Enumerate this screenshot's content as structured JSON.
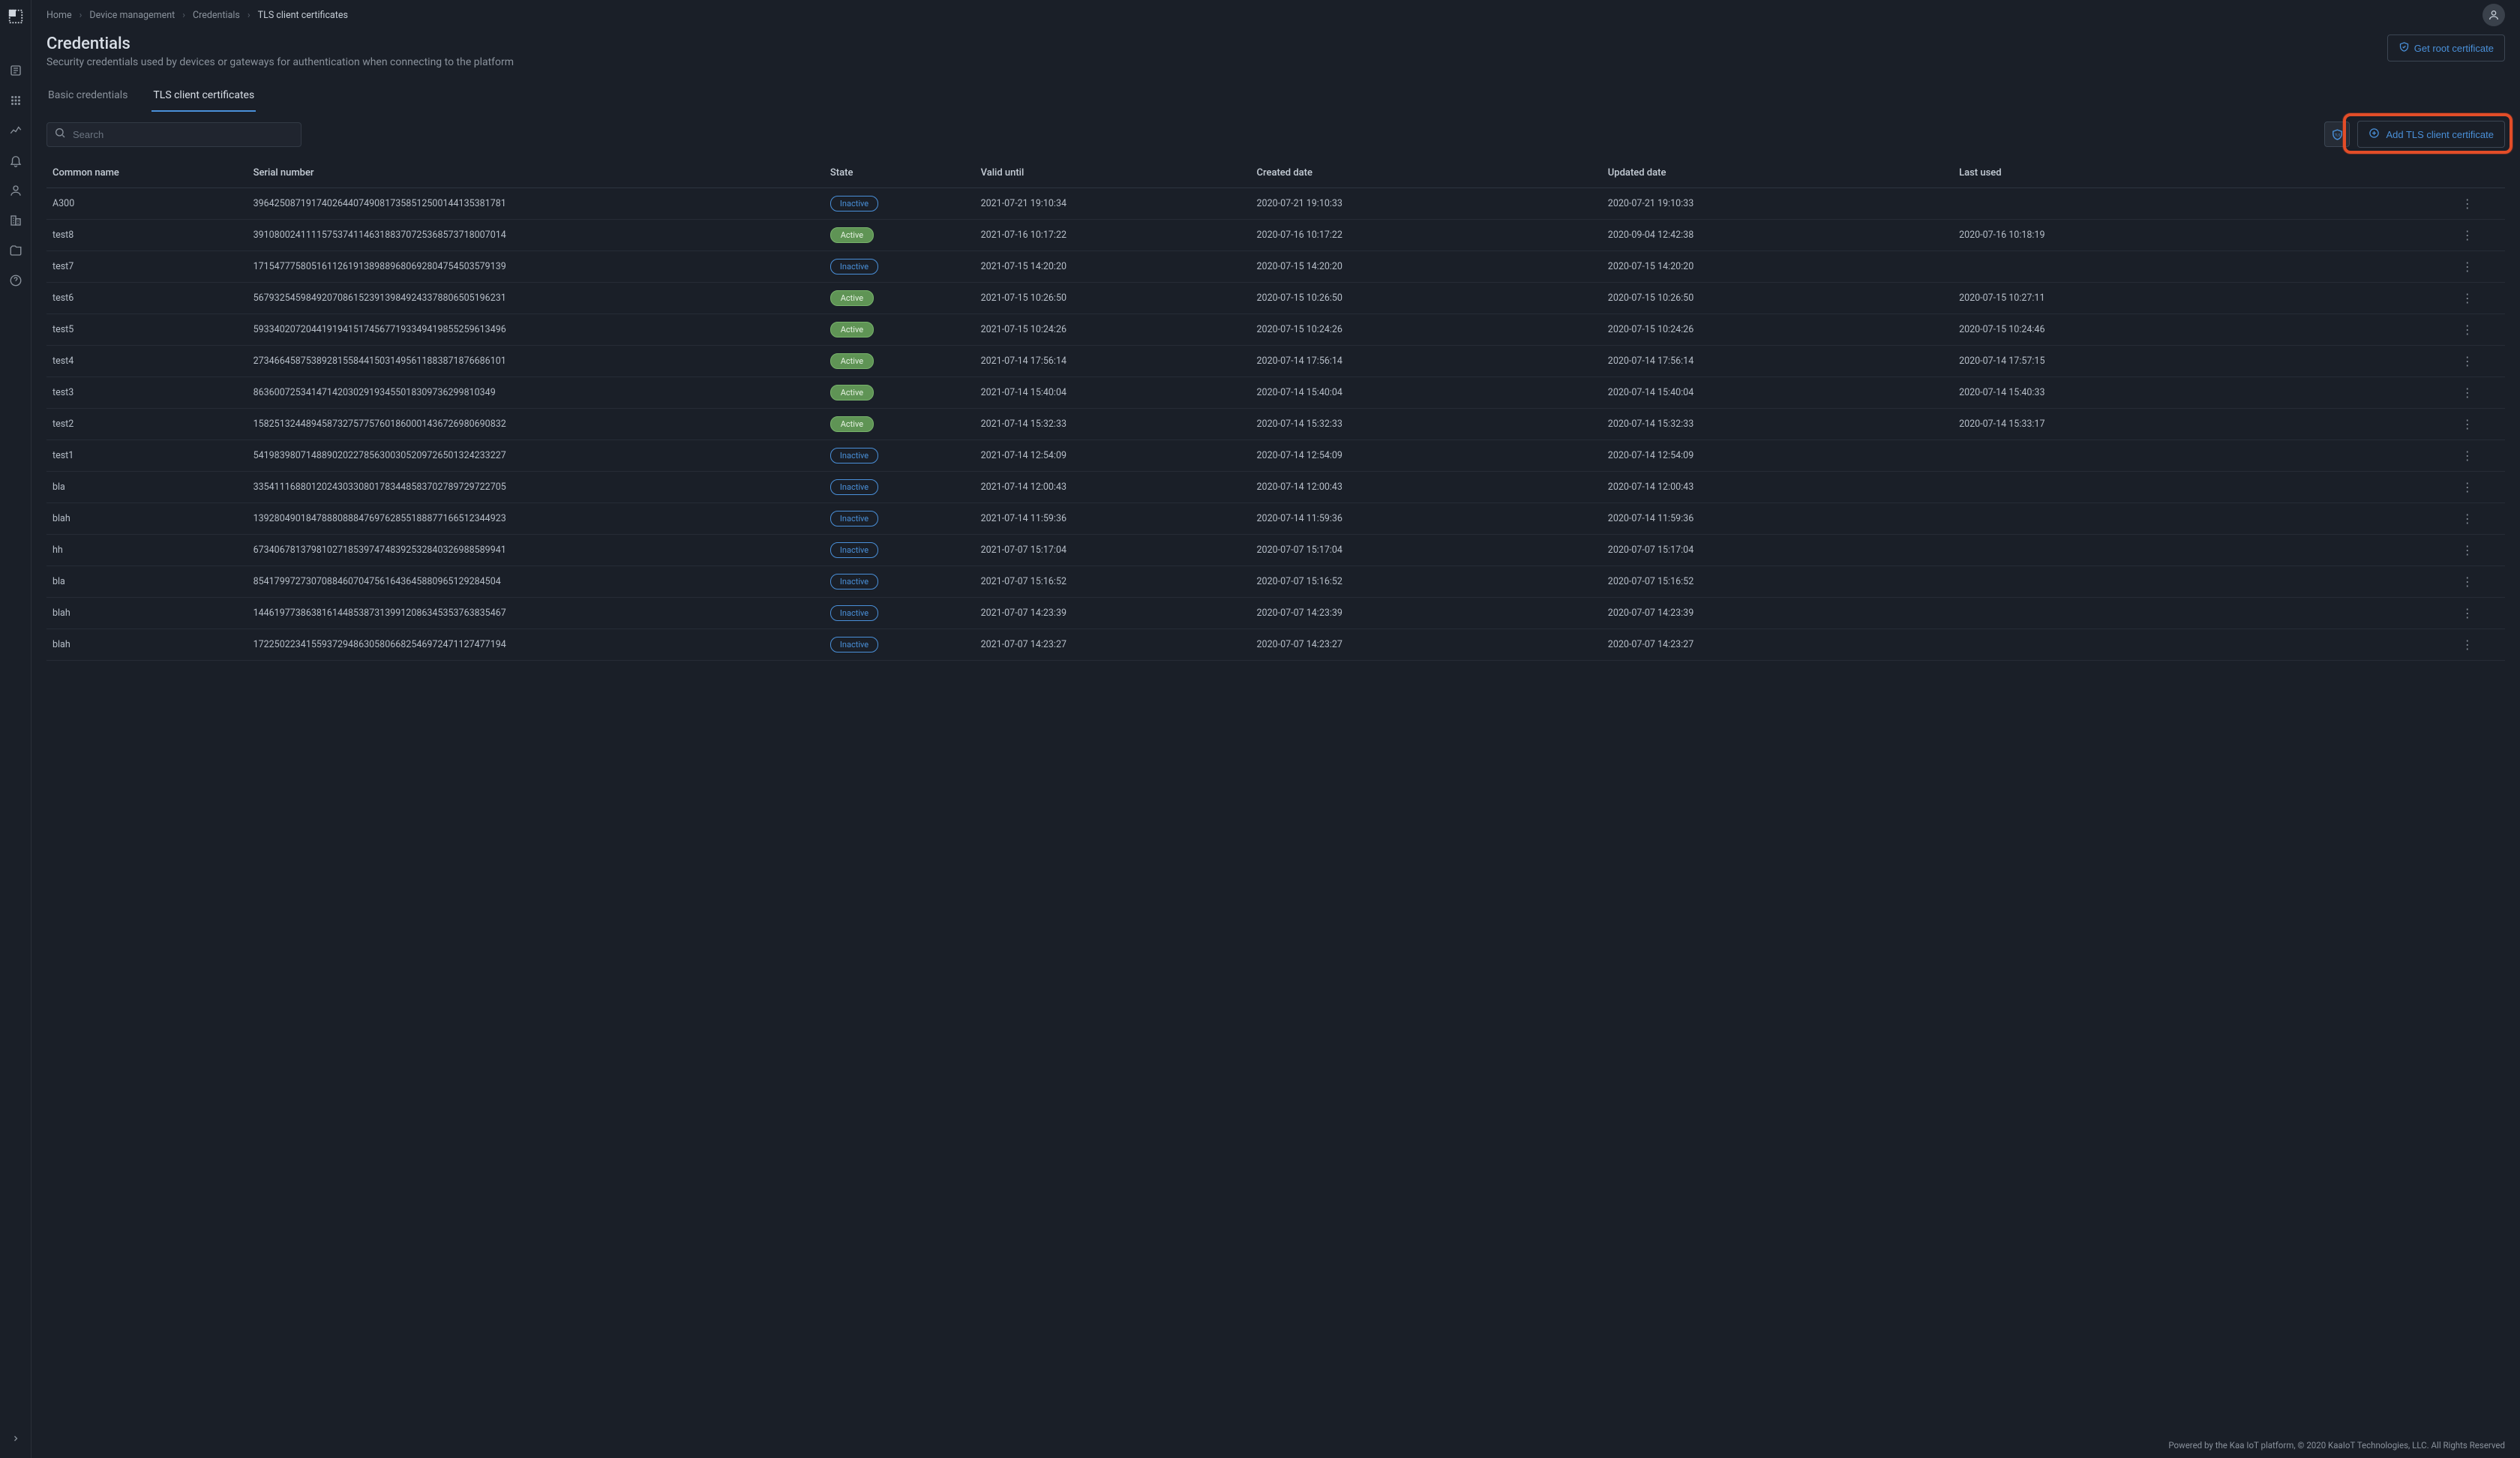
{
  "breadcrumb": [
    {
      "label": "Home"
    },
    {
      "label": "Device management"
    },
    {
      "label": "Credentials"
    },
    {
      "label": "TLS client certificates",
      "active": true
    }
  ],
  "header": {
    "title": "Credentials",
    "subtitle": "Security credentials used by devices or gateways for authentication when connecting to the platform",
    "get_root_cert": "Get root certificate"
  },
  "tabs": [
    {
      "label": "Basic credentials",
      "active": false
    },
    {
      "label": "TLS client certificates",
      "active": true
    }
  ],
  "search": {
    "placeholder": "Search"
  },
  "toolbar": {
    "add_tls": "Add TLS client certificate"
  },
  "columns": {
    "common": "Common name",
    "serial": "Serial number",
    "state": "State",
    "valid": "Valid until",
    "created": "Created date",
    "updated": "Updated date",
    "last": "Last used"
  },
  "rows": [
    {
      "common": "A300",
      "serial": "396425087191740264407490817358512500144135381781",
      "state": "Inactive",
      "valid": "2021-07-21 19:10:34",
      "created": "2020-07-21 19:10:33",
      "updated": "2020-07-21 19:10:33",
      "last": ""
    },
    {
      "common": "test8",
      "serial": "391080024111157537411463188370725368573718007014",
      "state": "Active",
      "valid": "2021-07-16 10:17:22",
      "created": "2020-07-16 10:17:22",
      "updated": "2020-09-04 12:42:38",
      "last": "2020-07-16 10:18:19"
    },
    {
      "common": "test7",
      "serial": "171547775805161126191389889680692804754503579139",
      "state": "Inactive",
      "valid": "2021-07-15 14:20:20",
      "created": "2020-07-15 14:20:20",
      "updated": "2020-07-15 14:20:20",
      "last": ""
    },
    {
      "common": "test6",
      "serial": "567932545984920708615239139849243378806505196231",
      "state": "Active",
      "valid": "2021-07-15 10:26:50",
      "created": "2020-07-15 10:26:50",
      "updated": "2020-07-15 10:26:50",
      "last": "2020-07-15 10:27:11"
    },
    {
      "common": "test5",
      "serial": "593340207204419194151745677193349419855259613496",
      "state": "Active",
      "valid": "2021-07-15 10:24:26",
      "created": "2020-07-15 10:24:26",
      "updated": "2020-07-15 10:24:26",
      "last": "2020-07-15 10:24:46"
    },
    {
      "common": "test4",
      "serial": "273466458753892815584415031495611883871876686101",
      "state": "Active",
      "valid": "2021-07-14 17:56:14",
      "created": "2020-07-14 17:56:14",
      "updated": "2020-07-14 17:56:14",
      "last": "2020-07-14 17:57:15"
    },
    {
      "common": "test3",
      "serial": "8636007253414714203029193455018309736299810349",
      "state": "Active",
      "valid": "2021-07-14 15:40:04",
      "created": "2020-07-14 15:40:04",
      "updated": "2020-07-14 15:40:04",
      "last": "2020-07-14 15:40:33"
    },
    {
      "common": "test2",
      "serial": "158251324489458732757757601860001436726980690832",
      "state": "Active",
      "valid": "2021-07-14 15:32:33",
      "created": "2020-07-14 15:32:33",
      "updated": "2020-07-14 15:32:33",
      "last": "2020-07-14 15:33:17"
    },
    {
      "common": "test1",
      "serial": "541983980714889020227856300305209726501324233227",
      "state": "Inactive",
      "valid": "2021-07-14 12:54:09",
      "created": "2020-07-14 12:54:09",
      "updated": "2020-07-14 12:54:09",
      "last": ""
    },
    {
      "common": "bla",
      "serial": "335411168801202430330801783448583702789729722705",
      "state": "Inactive",
      "valid": "2021-07-14 12:00:43",
      "created": "2020-07-14 12:00:43",
      "updated": "2020-07-14 12:00:43",
      "last": ""
    },
    {
      "common": "blah",
      "serial": "139280490184788808884769762855188877166512344923",
      "state": "Inactive",
      "valid": "2021-07-14 11:59:36",
      "created": "2020-07-14 11:59:36",
      "updated": "2020-07-14 11:59:36",
      "last": ""
    },
    {
      "common": "hh",
      "serial": "673406781379810271853974748392532840326988589941",
      "state": "Inactive",
      "valid": "2021-07-07 15:17:04",
      "created": "2020-07-07 15:17:04",
      "updated": "2020-07-07 15:17:04",
      "last": ""
    },
    {
      "common": "bla",
      "serial": "85417997273070884607047561643645880965129284504",
      "state": "Inactive",
      "valid": "2021-07-07 15:16:52",
      "created": "2020-07-07 15:16:52",
      "updated": "2020-07-07 15:16:52",
      "last": ""
    },
    {
      "common": "blah",
      "serial": "144619773863816144853873139912086345353763835467",
      "state": "Inactive",
      "valid": "2021-07-07 14:23:39",
      "created": "2020-07-07 14:23:39",
      "updated": "2020-07-07 14:23:39",
      "last": ""
    },
    {
      "common": "blah",
      "serial": "172250223415593729486305806682546972471127477194",
      "state": "Inactive",
      "valid": "2021-07-07 14:23:27",
      "created": "2020-07-07 14:23:27",
      "updated": "2020-07-07 14:23:27",
      "last": ""
    }
  ],
  "footer": "Powered by the Kaa IoT platform, © 2020 KaaIoT Technologies, LLC. All Rights Reserved"
}
